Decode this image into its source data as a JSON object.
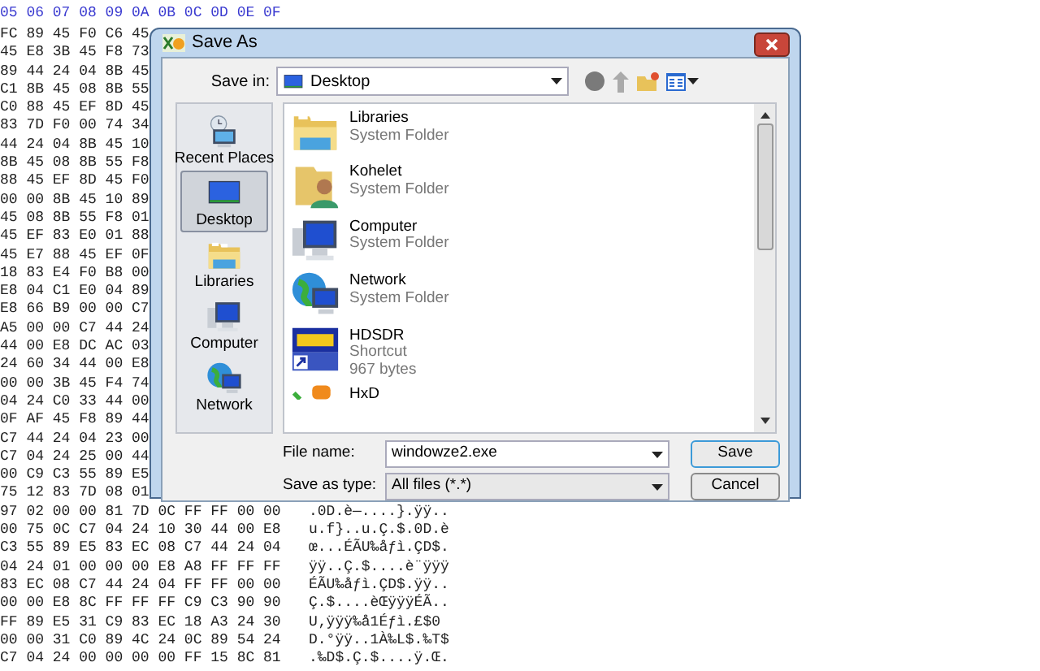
{
  "hex_editor": {
    "header": "05 06 07 08 09 0A 0B 0C 0D 0E 0F",
    "rows": [
      {
        "hex": "FC 89 45 F0 C6 45"
      },
      {
        "hex": "45 E8 3B 45 F8 73"
      },
      {
        "hex": "89 44 24 04 8B 45"
      },
      {
        "hex": "C1 8B 45 08 8B 55"
      },
      {
        "hex": "C0 88 45 EF 8D 45"
      },
      {
        "hex": "83 7D F0 00 74 34"
      },
      {
        "hex": "44 24 04 8B 45 10"
      },
      {
        "hex": "8B 45 08 8B 55 F8"
      },
      {
        "hex": "88 45 EF 8D 45 F0"
      },
      {
        "hex": "00 00 8B 45 10 89"
      },
      {
        "hex": "45 08 8B 55 F8 01"
      },
      {
        "hex": "45 EF 83 E0 01 88"
      },
      {
        "hex": "45 E7 88 45 EF 0F"
      },
      {
        "hex": "18 83 E4 F0 B8 00"
      },
      {
        "hex": "E8 04 C1 E0 04 89"
      },
      {
        "hex": "E8 66 B9 00 00 C7"
      },
      {
        "hex": "A5 00 00 C7 44 24"
      },
      {
        "hex": "44 00 E8 DC AC 03"
      },
      {
        "hex": "24 60 34 44 00 E8"
      },
      {
        "hex": "00 00 3B 45 F4 74"
      },
      {
        "hex": "04 24 C0 33 44 00"
      },
      {
        "hex": "0F AF 45 F8 89 44"
      },
      {
        "hex": "C7 44 24 04 23 00"
      },
      {
        "hex": "C7 04 24 25 00 44"
      },
      {
        "hex": "00 C9 C3 55 89 E5"
      },
      {
        "hex": "75 12 83 7D 08 01"
      },
      {
        "hex": "97 02 00 00 81 7D 0C FF FF 00 00",
        "ascii": ".0D.è—....}.ÿÿ.."
      },
      {
        "hex": "00 75 0C C7 04 24 10 30 44 00 E8",
        "ascii": "u.f}..u.Ç.$.0D.è"
      },
      {
        "hex": "C3 55 89 E5 83 EC 08 C7 44 24 04",
        "ascii": "œ...ÉÃU‰åƒì.ÇD$."
      },
      {
        "hex": "04 24 01 00 00 00 E8 A8 FF FF FF",
        "ascii": "ÿÿ..Ç.$....è¨ÿÿÿ"
      },
      {
        "hex": "83 EC 08 C7 44 24 04 FF FF 00 00",
        "ascii": "ÉÃU‰åƒì.ÇD$.ÿÿ.."
      },
      {
        "hex": "00 00 E8 8C FF FF FF C9 C3 90 90",
        "ascii": "Ç.$....èŒÿÿÿÉÃ.."
      },
      {
        "hex": "FF 89 E5 31 C9 83 EC 18 A3 24 30",
        "ascii": "U‚ÿÿÿ‰å1Éƒì.£$0"
      },
      {
        "hex": "00 00 31 C0 89 4C 24 0C 89 54 24",
        "ascii": "D.°ÿÿ..1À‰L$.‰T$"
      },
      {
        "hex": "C7 04 24 00 00 00 00 FF 15 8C 81",
        "ascii": ".‰D$.Ç.$....ÿ.Œ."
      }
    ]
  },
  "dialog": {
    "title": "Save As",
    "save_in": {
      "label": "Save in:",
      "value": "Desktop"
    },
    "places": [
      {
        "label": "Recent Places",
        "kind": "recent",
        "selected": false
      },
      {
        "label": "Desktop",
        "kind": "desktop",
        "selected": true
      },
      {
        "label": "Libraries",
        "kind": "libraries",
        "selected": false
      },
      {
        "label": "Computer",
        "kind": "computer",
        "selected": false
      },
      {
        "label": "Network",
        "kind": "network",
        "selected": false
      }
    ],
    "files": [
      {
        "name": "Libraries",
        "kind": "libraries",
        "details": [
          "System Folder"
        ]
      },
      {
        "name": "Kohelet",
        "kind": "user",
        "details": [
          "System Folder"
        ]
      },
      {
        "name": "Computer",
        "kind": "computer",
        "details": [
          "System Folder"
        ]
      },
      {
        "name": "Network",
        "kind": "network",
        "details": [
          "System Folder"
        ]
      },
      {
        "name": "HDSDR",
        "kind": "shortcut",
        "details": [
          "Shortcut",
          "967 bytes"
        ]
      },
      {
        "name": "HxD",
        "kind": "app"
      }
    ],
    "file_name": {
      "label": "File name:",
      "value": "windowze2.exe"
    },
    "save_as_type": {
      "label": "Save as type:",
      "value": "All files (*.*)"
    },
    "buttons": [
      {
        "label": "Save",
        "default": true
      },
      {
        "label": "Cancel",
        "default": false
      }
    ]
  }
}
